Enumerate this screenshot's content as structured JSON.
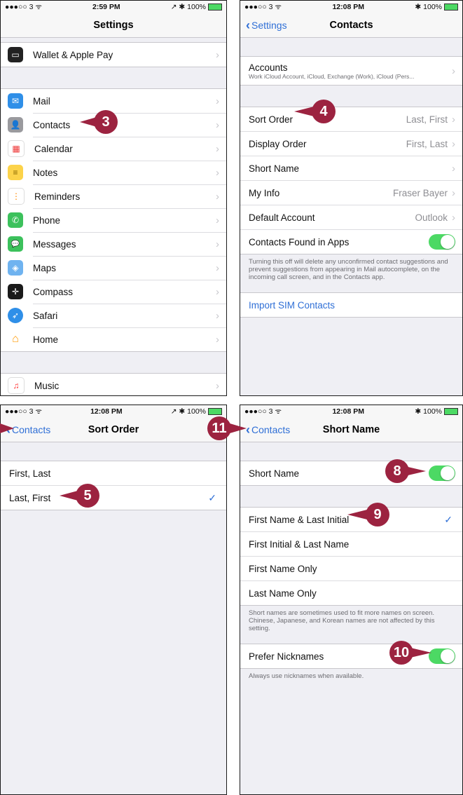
{
  "status": {
    "s1": {
      "carrier": "●●●○○ 3 ᯤ",
      "time": "2:59 PM",
      "right": "↗ ✱ 100%"
    },
    "s2": {
      "carrier": "●●●○○ 3 ᯤ",
      "time": "12:08 PM",
      "right": "✱ 100%"
    },
    "s3": {
      "carrier": "●●●○○ 3 ᯤ",
      "time": "12:08 PM",
      "right": "↗ ✱ 100%"
    },
    "s4": {
      "carrier": "●●●○○ 3 ᯤ",
      "time": "12:08 PM",
      "right": "✱ 100%"
    }
  },
  "settings": {
    "title": "Settings",
    "wallet": "Wallet & Apple Pay",
    "items": [
      "Mail",
      "Contacts",
      "Calendar",
      "Notes",
      "Reminders",
      "Phone",
      "Messages",
      "Maps",
      "Compass",
      "Safari",
      "Home"
    ],
    "music": "Music"
  },
  "contacts": {
    "back": "Settings",
    "title": "Contacts",
    "accounts": "Accounts",
    "accounts_sub": "Work iCloud Account, iCloud, Exchange (Work), iCloud (Pers...",
    "sort_order": "Sort Order",
    "sort_order_value": "Last, First",
    "display_order": "Display Order",
    "display_order_value": "First, Last",
    "short_name": "Short Name",
    "my_info": "My Info",
    "my_info_value": "Fraser Bayer",
    "default_account": "Default Account",
    "default_account_value": "Outlook",
    "found_in_apps": "Contacts Found in Apps",
    "found_footer": "Turning this off will delete any unconfirmed contact suggestions and prevent suggestions from appearing in Mail autocomplete, on the incoming call screen, and in the Contacts app.",
    "import_sim": "Import SIM Contacts"
  },
  "sortorder": {
    "back": "Contacts",
    "title": "Sort Order",
    "options": [
      "First, Last",
      "Last, First"
    ]
  },
  "shortname": {
    "back": "Contacts",
    "title": "Short Name",
    "short_name": "Short Name",
    "options": [
      "First Name & Last Initial",
      "First Initial & Last Name",
      "First Name Only",
      "Last Name Only"
    ],
    "footer": "Short names are sometimes used to fit more names on screen. Chinese, Japanese, and Korean names are not affected by this setting.",
    "prefer_nicknames": "Prefer Nicknames",
    "nick_footer": "Always use nicknames when available."
  },
  "callouts": {
    "c3": "3",
    "c4": "4",
    "c5": "5",
    "c8": "8",
    "c9": "9",
    "c10": "10",
    "c11": "11"
  },
  "icons": {
    "mail": "✉",
    "contacts": "👤",
    "calendar": "▦",
    "notes": "≡",
    "reminders": "⋮",
    "phone": "✆",
    "messages": "💬",
    "maps": "◈",
    "compass": "✛",
    "safari": "➶",
    "home": "⌂",
    "music": "♫",
    "wallet": "▭"
  },
  "colors": {
    "accent": "#2f6fd6",
    "toggle_on": "#4cd964",
    "callout": "#9c2340"
  }
}
